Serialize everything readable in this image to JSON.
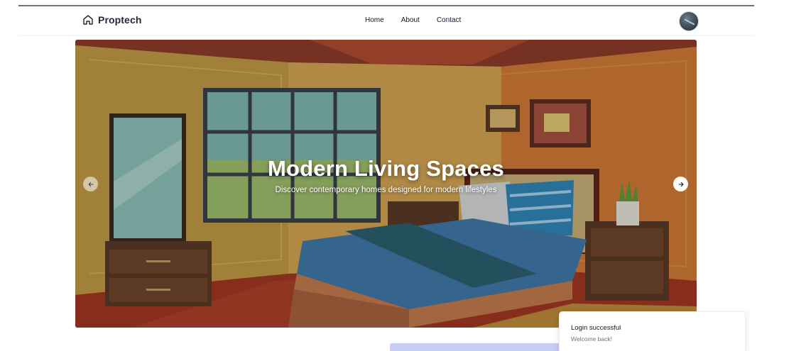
{
  "navbar": {
    "brand": "Proptech",
    "brand_icon": "home-icon",
    "links": [
      {
        "label": "Home"
      },
      {
        "label": "About"
      },
      {
        "label": "Contact"
      }
    ],
    "avatar_icon": "user-avatar"
  },
  "hero": {
    "title": "Modern Living Spaces",
    "subtitle": "Discover contemporary homes designed for modern lifestyles",
    "prev_icon": "arrow-left-icon",
    "next_icon": "arrow-right-icon"
  },
  "toast": {
    "title": "Login successful",
    "description": "Welcome back!"
  },
  "colors": {
    "accent_bar": "#c7cdf3",
    "wall": "#c9913a",
    "floor": "#a5371f",
    "bedspread": "#3f79a8"
  }
}
